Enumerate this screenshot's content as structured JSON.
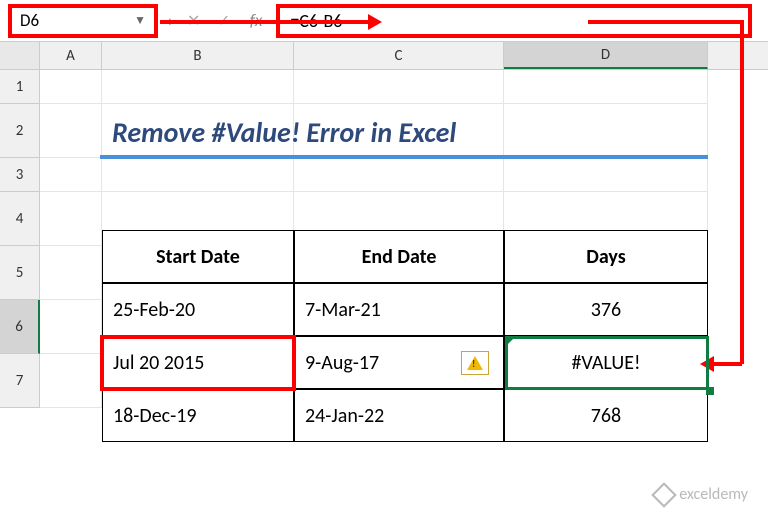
{
  "formula_bar": {
    "name_box": "D6",
    "fx_label": "fx",
    "formula": "=C6-B6"
  },
  "columns": [
    "A",
    "B",
    "C",
    "D"
  ],
  "row_numbers": [
    "1",
    "2",
    "3",
    "4",
    "5",
    "6",
    "7"
  ],
  "title": "Remove #Value! Error in Excel",
  "table": {
    "headers": {
      "b": "Start Date",
      "c": "End Date",
      "d": "Days"
    },
    "rows": [
      {
        "b": "25-Feb-20",
        "c": "7-Mar-21",
        "d": "376"
      },
      {
        "b": "Jul 20 2015",
        "c": "9-Aug-17",
        "d": "#VALUE!"
      },
      {
        "b": "18-Dec-19",
        "c": "24-Jan-22",
        "d": "768"
      }
    ]
  },
  "watermark": "exceldemy",
  "selected_cell": "D6",
  "chart_data": {
    "type": "table",
    "title": "Remove #Value! Error in Excel",
    "columns": [
      "Start Date",
      "End Date",
      "Days"
    ],
    "rows": [
      [
        "25-Feb-20",
        "7-Mar-21",
        376
      ],
      [
        "Jul 20 2015",
        "9-Aug-17",
        "#VALUE!"
      ],
      [
        "18-Dec-19",
        "24-Jan-22",
        768
      ]
    ],
    "formula_for_days": "=C6-B6"
  }
}
